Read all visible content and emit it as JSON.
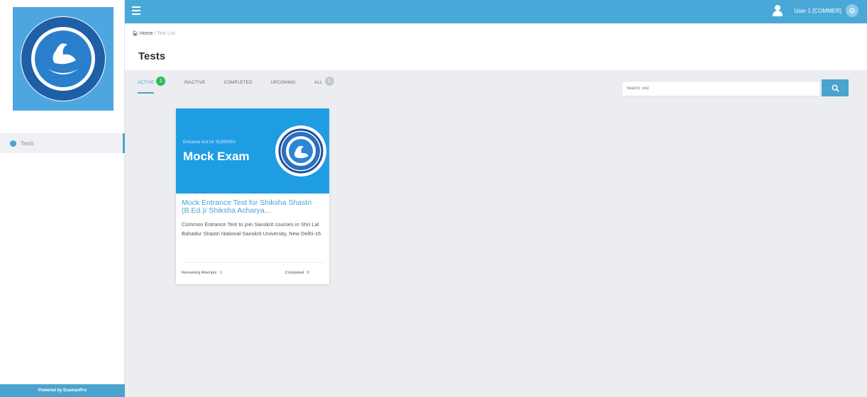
{
  "topbar": {
    "user_label": "User 1 [COMMER]"
  },
  "sidebar": {
    "items": [
      {
        "label": "Tests"
      }
    ],
    "powered_by": "Powered by ExamanPro"
  },
  "breadcrumb": {
    "home": "Home",
    "separator": "/",
    "current": "Test List"
  },
  "page": {
    "title": "Tests"
  },
  "tabs": [
    {
      "label": "Active",
      "badge": "1"
    },
    {
      "label": "Inactive"
    },
    {
      "label": "Completed"
    },
    {
      "label": "Upcoming"
    },
    {
      "label": "All",
      "badge": "1"
    }
  ],
  "search": {
    "placeholder": "Search Test"
  },
  "card": {
    "banner_subtitle": "Entrance test for SLBSNSU",
    "banner_title": "Mock Exam",
    "title": "Mock Entrance Test for Shiksha Shastri (B.Ed.)/ Shiksha Acharya...",
    "description": "Common Entrance Test to join Sanskrit courses in Shri Lal Bahadur Shastri National Sanskrit University, New Delhi-16",
    "remaining_label": "Remaining Attempts :",
    "remaining_value": "1",
    "completed_label": "Completed :",
    "completed_value": "0"
  },
  "colors": {
    "accent": "#4aa3cf",
    "topbar": "#4aa8d8",
    "badge_active": "#2ebd59"
  }
}
